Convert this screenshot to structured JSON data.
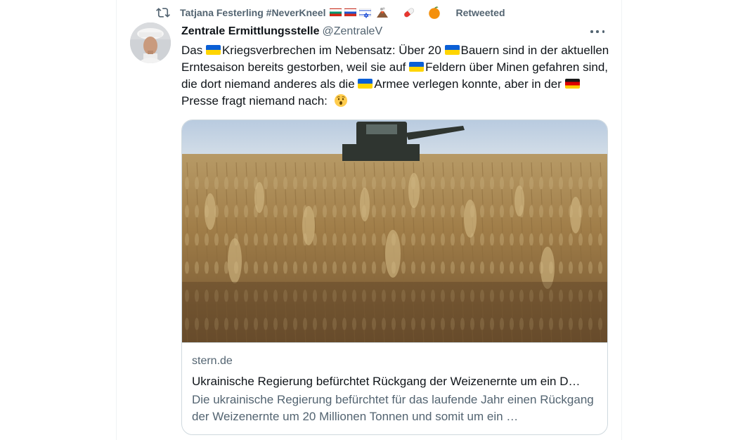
{
  "retweet": {
    "user": "Tatjana Festerling #NeverKneel",
    "suffix": "Retweeted",
    "badges": [
      "flag-bulgaria",
      "flag-russia",
      "flag-israel",
      "volcano-icon",
      "pill-icon",
      "orange-icon"
    ]
  },
  "tweet": {
    "display_name": "Zentrale Ermittlungsstelle",
    "handle": "@ZentraleV",
    "text_segments": [
      "Das ",
      "Kriegsverbrechen im Nebensatz: Über 20 ",
      "Bauern sind in der aktuellen Erntesaison bereits gestorben, weil sie auf ",
      "Feldern über Minen gefahren sind, die dort niemand anderes als die ",
      "Armee verlegen konnte, aber in der ",
      "Presse fragt niemand nach: "
    ],
    "inline_icons": [
      "flag-ukraine",
      "flag-ukraine",
      "flag-ukraine",
      "flag-ukraine",
      "flag-germany",
      "hushed-face-icon"
    ]
  },
  "card": {
    "domain": "stern.de",
    "title": "Ukrainische Regierung befürchtet Rückgang der Weizenernte um ein D…",
    "description": "Die ukrainische Regierung befürchtet für das laufende Jahr einen Rückgang der Weizenernte um 20 Millionen Tonnen und somit um ein …",
    "image_subject": "wheat-field-with-combine-harvester"
  },
  "colors": {
    "text_primary": "#0f1419",
    "text_secondary": "#536471",
    "border": "#cfd9de",
    "divider": "#eff3f4"
  }
}
